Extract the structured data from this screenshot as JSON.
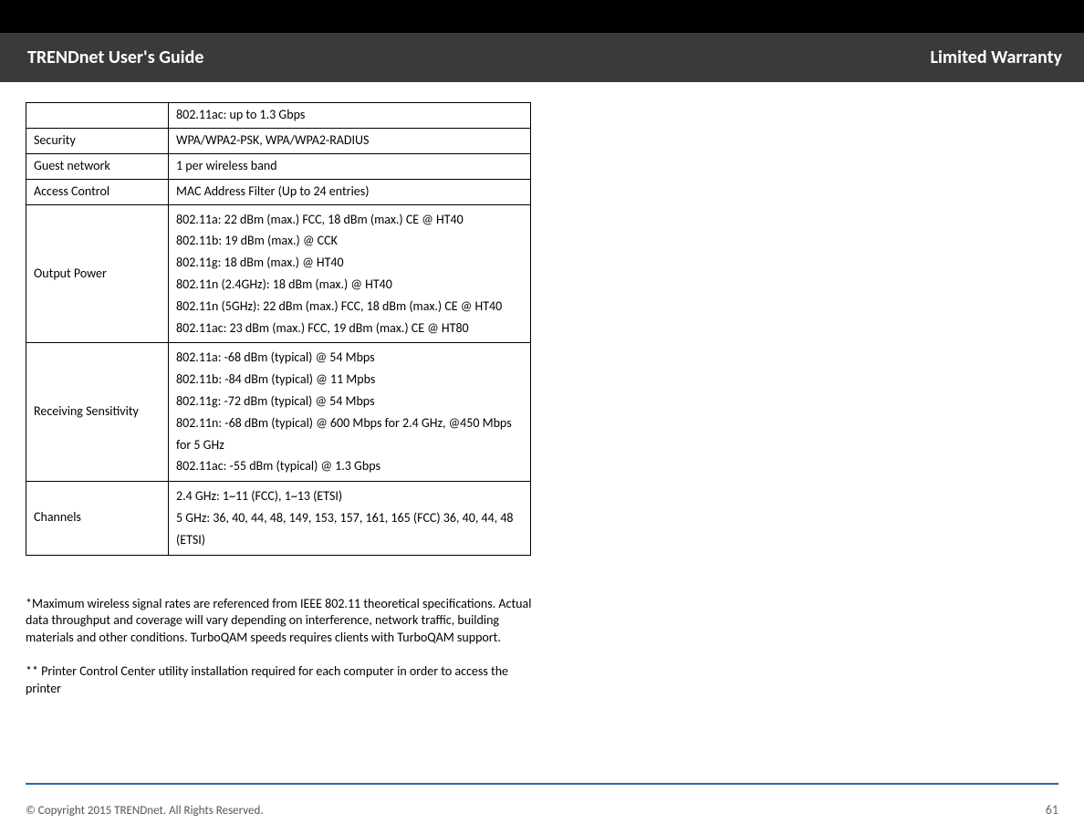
{
  "header": {
    "left": "TRENDnet User's Guide",
    "right": "Limited Warranty"
  },
  "table": {
    "rows": [
      {
        "label": "",
        "value_lines": [
          "802.11ac: up to 1.3 Gbps"
        ]
      },
      {
        "label": "Security",
        "value_lines": [
          "WPA/WPA2-PSK, WPA/WPA2-RADIUS"
        ]
      },
      {
        "label": "Guest network",
        "value_lines": [
          "1 per wireless band"
        ]
      },
      {
        "label": "Access Control",
        "value_lines": [
          "MAC Address Filter (Up to 24 entries)"
        ]
      },
      {
        "label": "Output Power",
        "value_lines": [
          "802.11a: 22 dBm (max.) FCC, 18 dBm (max.) CE  @ HT40",
          "802.11b: 19 dBm (max.) @ CCK",
          "802.11g: 18 dBm (max.) @ HT40",
          "802.11n (2.4GHz): 18 dBm (max.) @ HT40",
          "802.11n (5GHz): 22 dBm (max.) FCC, 18 dBm (max.) CE @ HT40",
          "802.11ac: 23 dBm (max.) FCC, 19 dBm (max.) CE @ HT80"
        ]
      },
      {
        "label": "Receiving Sensitivity",
        "value_lines": [
          "802.11a: -68 dBm (typical) @ 54 Mbps",
          "802.11b: -84 dBm (typical) @ 11 Mpbs",
          "802.11g: -72 dBm (typical) @ 54 Mbps",
          "802.11n: -68 dBm (typical) @ 600 Mbps for 2.4 GHz, @450 Mbps for 5 GHz",
          "802.11ac: -55 dBm (typical) @ 1.3 Gbps"
        ]
      },
      {
        "label": "Channels",
        "value_lines": [
          "2.4 GHz: 1~11 (FCC), 1~13 (ETSI)",
          "5 GHz:  36, 40, 44, 48, 149, 153, 157, 161, 165 (FCC) 36, 40, 44, 48 (ETSI)"
        ]
      }
    ]
  },
  "footnotes": {
    "p1": "*Maximum wireless signal rates are referenced from IEEE 802.11 theoretical specifications. Actual data throughput and coverage will vary depending on interference, network traffic, building materials and other conditions. TurboQAM speeds requires clients with TurboQAM support.",
    "p2": "** Printer Control Center utility installation required for each computer in order to access the printer"
  },
  "footer": {
    "copyright": "© Copyright 2015 TRENDnet. All Rights Reserved.",
    "page_number": "61"
  }
}
